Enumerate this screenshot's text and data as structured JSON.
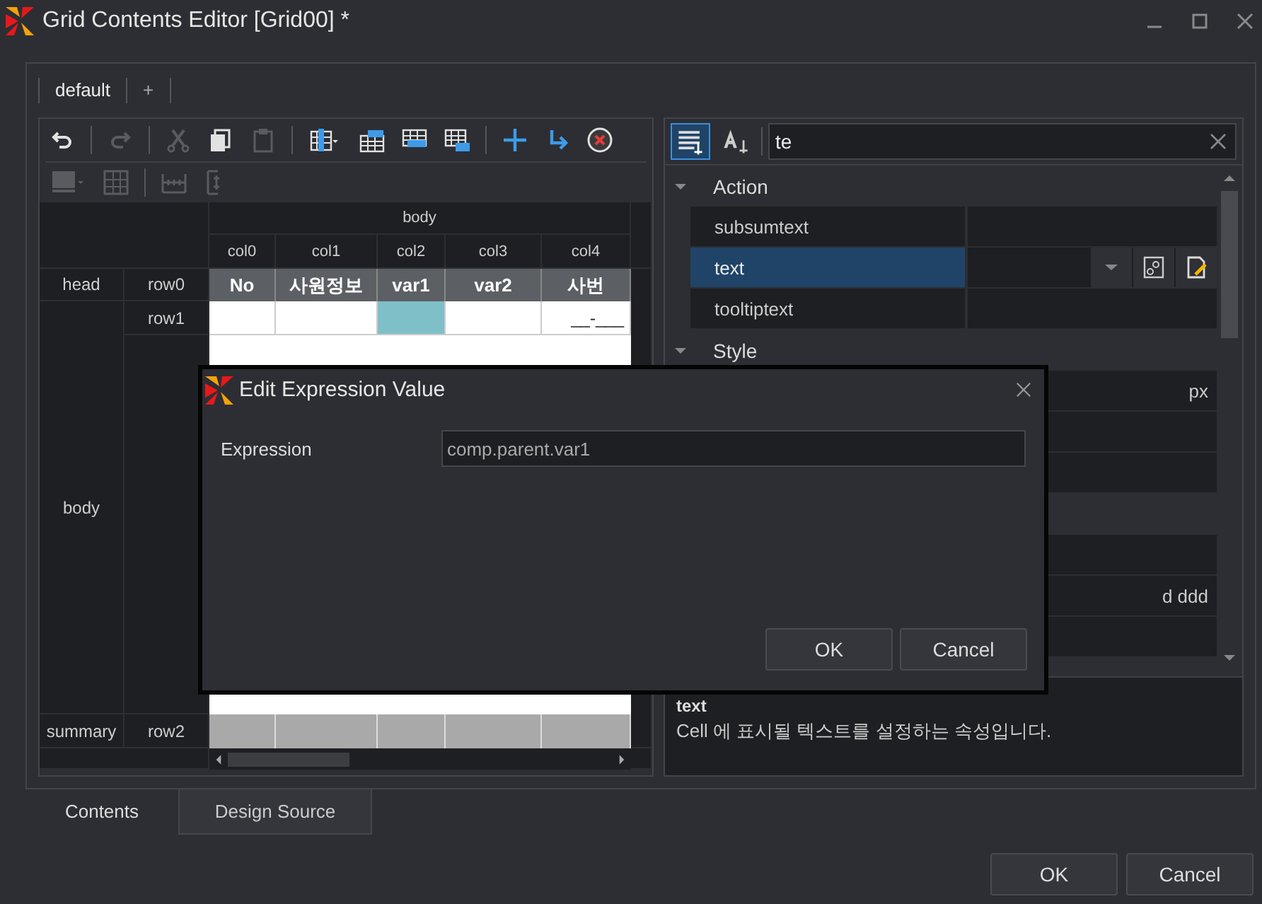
{
  "window": {
    "title": "Grid Contents Editor [Grid00] *"
  },
  "doc_tabs": [
    {
      "label": "default",
      "selected": true
    },
    {
      "label": "+",
      "selected": false
    }
  ],
  "toolbar": {
    "row1": [
      {
        "disabled": false
      },
      {
        "disabled": true
      },
      {
        "disabled": true
      },
      {
        "disabled": false
      },
      {
        "disabled": true
      },
      {
        "disabled": false
      },
      {
        "disabled": false
      },
      {
        "disabled": false
      },
      {
        "disabled": false
      },
      {
        "disabled": false
      },
      {
        "disabled": false
      },
      {
        "disabled": false
      }
    ],
    "row2": [
      {
        "disabled": true
      },
      {
        "disabled": true
      },
      {
        "disabled": true
      },
      {
        "disabled": true
      }
    ]
  },
  "grid": {
    "band": "body",
    "columns": [
      "col0",
      "col1",
      "col2",
      "col3",
      "col4"
    ],
    "head": {
      "band": "head",
      "row": "row0",
      "cells": [
        {
          "text": "No",
          "selected": false
        },
        {
          "text": "사원정보",
          "selected": false
        },
        {
          "text": "var1",
          "selected": false
        },
        {
          "text": "var2",
          "selected": false
        },
        {
          "text": "사번",
          "selected": false
        }
      ]
    },
    "body": {
      "band": "body",
      "row": "row1",
      "cells": [
        {
          "selected": false
        },
        {
          "selected": false
        },
        {
          "selected": true
        },
        {
          "selected": false
        },
        {
          "text": "__-___",
          "selected": false
        }
      ]
    },
    "summary": {
      "band": "summary",
      "row": "row2"
    }
  },
  "properties": {
    "sort_modes": [
      {
        "selected": true
      },
      {
        "selected": false
      }
    ],
    "search": {
      "value": "te"
    },
    "categories": [
      {
        "name": "Action",
        "expanded": true,
        "rows": [
          {
            "name": "subsumtext",
            "selected": false
          },
          {
            "name": "text",
            "selected": true
          },
          {
            "name": "tooltiptext",
            "selected": false
          }
        ]
      },
      {
        "name": "Style",
        "expanded": true,
        "rows": [
          {
            "value": "px"
          },
          {},
          {}
        ]
      },
      {
        "rows": [
          {},
          {
            "value": "d ddd"
          },
          {}
        ]
      }
    ],
    "description": {
      "title": "text",
      "text": "Cell 에 표시될 텍스트를 설정하는 속성입니다."
    }
  },
  "bottom_tabs": [
    {
      "label": "Contents",
      "selected": true
    },
    {
      "label": "Design Source",
      "selected": false
    }
  ],
  "buttons": [
    "OK",
    "Cancel"
  ],
  "dialog": {
    "title": "Edit Expression Value",
    "label": "Expression",
    "value": "comp.parent.var1",
    "buttons": [
      "OK",
      "Cancel"
    ]
  }
}
